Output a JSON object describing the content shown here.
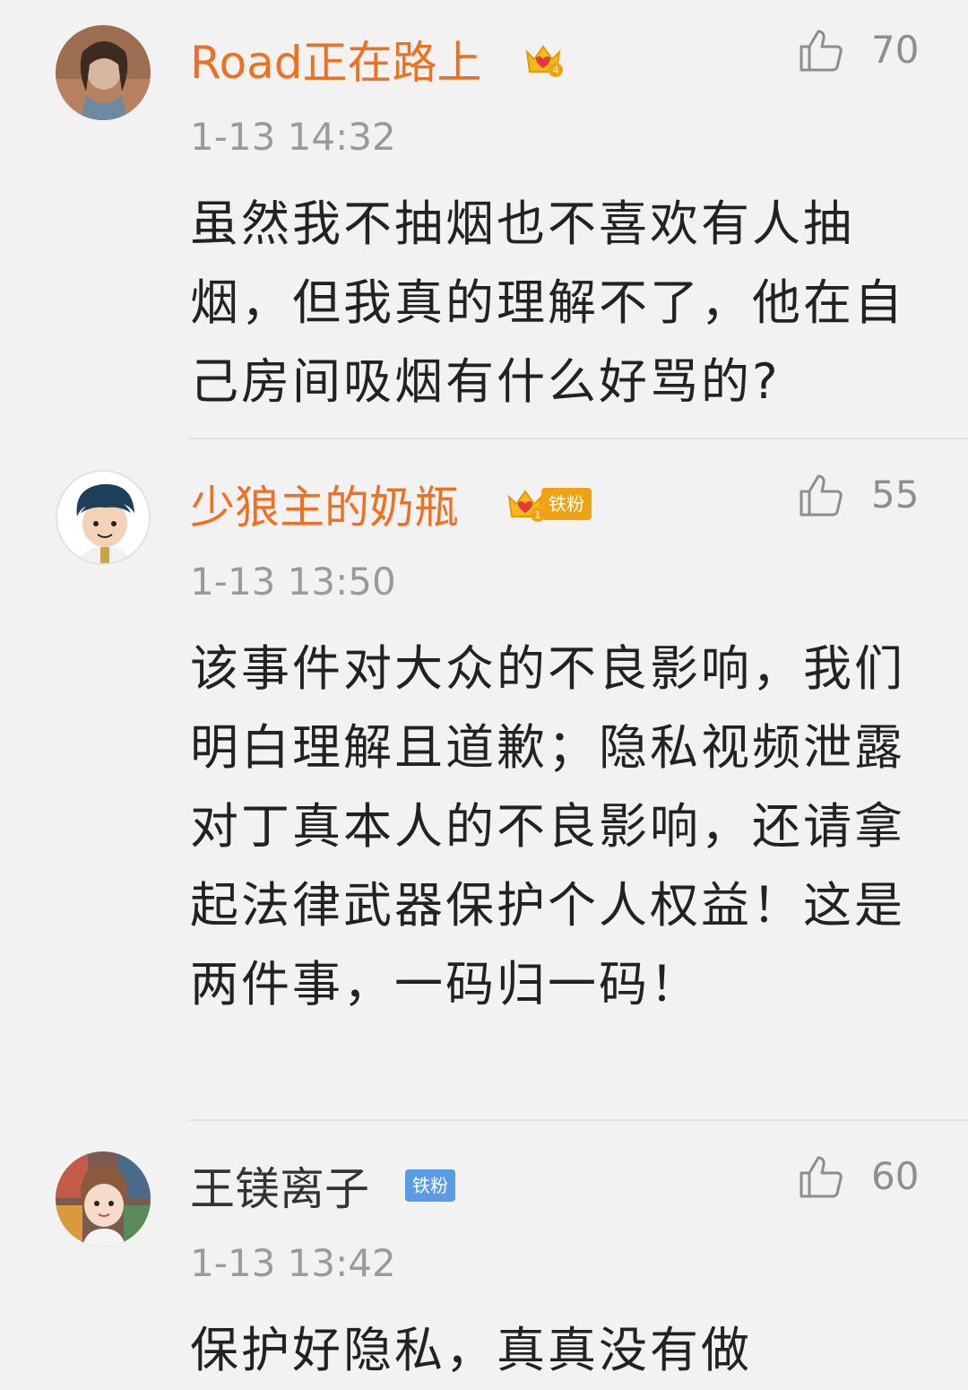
{
  "comments": [
    {
      "username": "Road正在路上",
      "crown_level": "4",
      "time": "1-13 14:32",
      "likes": "70",
      "content": "虽然我不抽烟也不喜欢有人抽烟，但我真的理解不了，他在自己房间吸烟有什么好骂的?"
    },
    {
      "username": "少狼主的奶瓶",
      "crown_level": "1",
      "badge": "铁粉",
      "time": "1-13 13:50",
      "likes": "55",
      "content": "该事件对大众的不良影响，我们明白理解且道歉；隐私视频泄露对丁真本人的不良影响，还请拿起法律武器保护个人权益！这是两件事，一码归一码！"
    },
    {
      "username": "王镁离子",
      "badge": "铁粉",
      "time": "1-13 13:42",
      "likes": "60",
      "content": "保护好隐私，真真没有做"
    }
  ],
  "icons": {
    "like": "thumbs-up-icon",
    "crown": "crown-icon"
  },
  "colors": {
    "background": "#f2f2f2",
    "vip_name": "#f0701f",
    "normal_name": "#333333",
    "time": "#9a9a9a",
    "content": "#222222",
    "crown_gold": "#f6b91d",
    "crown_badge": "#f0a312",
    "fan_badge_blue": "#5b9be6"
  }
}
